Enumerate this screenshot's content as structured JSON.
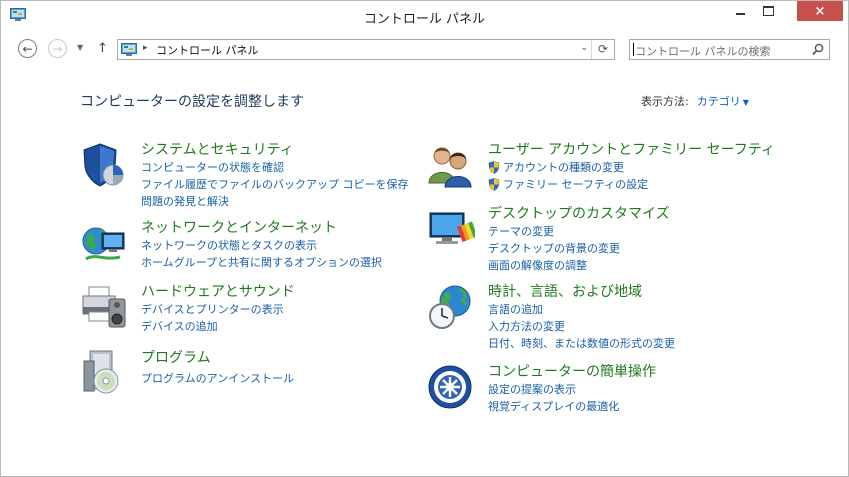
{
  "window": {
    "title": "コントロール パネル",
    "close_label": "×"
  },
  "nav": {
    "back_glyph": "←",
    "forward_glyph": "→",
    "recent_glyph": "▼",
    "up_glyph": "↑",
    "address_separator": "▸",
    "address_text": "コントロール パネル",
    "address_dropdown_glyph": "⌄",
    "refresh_glyph": "⟳",
    "search_placeholder": "コントロール パネルの検索"
  },
  "header": {
    "heading": "コンピューターの設定を調整します",
    "view_by_label": "表示方法:",
    "view_by_value": "カテゴリ",
    "view_by_arrow": "▼"
  },
  "categories_left": [
    {
      "title": "システムとセキュリティ",
      "icon": "security-shield-icon",
      "links": [
        "コンピューターの状態を確認",
        "ファイル履歴でファイルのバックアップ コピーを保存",
        "問題の発見と解決"
      ]
    },
    {
      "title": "ネットワークとインターネット",
      "icon": "network-globe-icon",
      "links": [
        "ネットワークの状態とタスクの表示",
        "ホームグループと共有に関するオプションの選択"
      ]
    },
    {
      "title": "ハードウェアとサウンド",
      "icon": "printer-speaker-icon",
      "links": [
        "デバイスとプリンターの表示",
        "デバイスの追加"
      ]
    },
    {
      "title": "プログラム",
      "icon": "programs-disc-icon",
      "links": [
        "プログラムのアンインストール"
      ]
    }
  ],
  "categories_right": [
    {
      "title": "ユーザー アカウントとファミリー セーフティ",
      "icon": "users-icon",
      "links": [
        "アカウントの種類の変更",
        "ファミリー セーフティの設定"
      ]
    },
    {
      "title": "デスクトップのカスタマイズ",
      "icon": "desktop-palette-icon",
      "links": [
        "テーマの変更",
        "デスクトップの背景の変更",
        "画面の解像度の調整"
      ]
    },
    {
      "title": "時計、言語、および地域",
      "icon": "clock-globe-icon",
      "links": [
        "言語の追加",
        "入力方法の変更",
        "日付、時刻、または数値の形式の変更"
      ]
    },
    {
      "title": "コンピューターの簡単操作",
      "icon": "ease-of-access-icon",
      "links": [
        "設定の提案の表示",
        "視覚ディスプレイの最適化"
      ]
    }
  ],
  "colors": {
    "title_green": "#1e7a1e",
    "link_blue": "#1a5fa8",
    "heading_navy": "#1e395b",
    "close_red": "#c7504c"
  }
}
